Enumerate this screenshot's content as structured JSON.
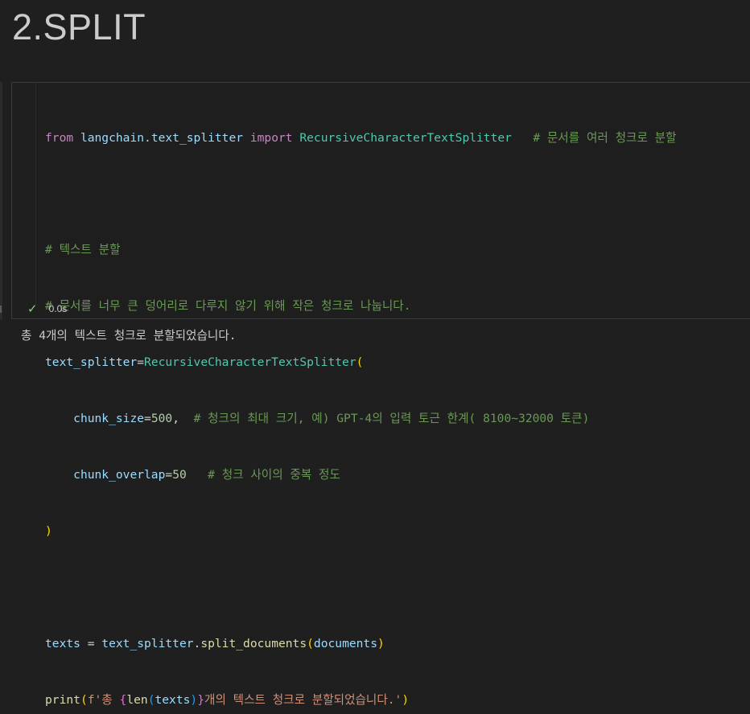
{
  "heading": "2.SPLIT",
  "code_lines": [
    "from langchain.text_splitter import RecursiveCharacterTextSplitter   # 문서를 여러 청크로 분할",
    "",
    "# 텍스트 분할",
    "# 문서를 너무 큰 덩어리로 다루지 않기 위해 작은 청크로 나눕니다.",
    "text_splitter=RecursiveCharacterTextSplitter(",
    "    chunk_size=500,  # 청크의 최대 크기, 예) GPT-4의 입력 토근 한계( 8100~32000 토큰)",
    "    chunk_overlap=50   # 청크 사이의 중복 정도",
    ")",
    "",
    "texts = text_splitter.split_documents(documents)",
    "print(f'총 {len(texts)}개의 텍스트 청크로 분할되었습니다.')"
  ],
  "tokens": {
    "l0": {
      "from": "from",
      "module": "langchain.text_splitter",
      "import": "import",
      "cls": "RecursiveCharacterTextSplitter",
      "comment": "# 문서를 여러 청크로 분할"
    },
    "l2": {
      "comment": "# 텍스트 분할"
    },
    "l3": {
      "comment": "# 문서를 너무 큰 덩어리로 다루지 않기 위해 작은 청크로 나눕니다."
    },
    "l4": {
      "var": "text_splitter",
      "eq": "=",
      "cls": "RecursiveCharacterTextSplitter",
      "open": "("
    },
    "l5": {
      "param": "chunk_size",
      "eq": "=",
      "num": "500",
      "comma": ",",
      "comment": "# 청크의 최대 크기, 예) GPT-4의 입력 토근 한계( 8100~32000 토큰)"
    },
    "l6": {
      "param": "chunk_overlap",
      "eq": "=",
      "num": "50",
      "comment": "# 청크 사이의 중복 정도"
    },
    "l7": {
      "close": ")"
    },
    "l9": {
      "var": "texts",
      "eq": " = ",
      "obj": "text_splitter",
      "dot": ".",
      "fn": "split_documents",
      "open": "(",
      "arg": "documents",
      "close": ")"
    },
    "l10": {
      "fn": "print",
      "open": "(",
      "str1": "f'총 ",
      "br_open": "{",
      "fn2": "len",
      "open2": "(",
      "arg": "texts",
      "close2": ")",
      "br_close": "}",
      "str2": "개의 텍스트 청크로 분할되었습니다.'",
      "close": ")"
    }
  },
  "status": {
    "icon": "check-icon",
    "time": "0.0s"
  },
  "output": "총 4개의 텍스트 청크로 분할되었습니다."
}
